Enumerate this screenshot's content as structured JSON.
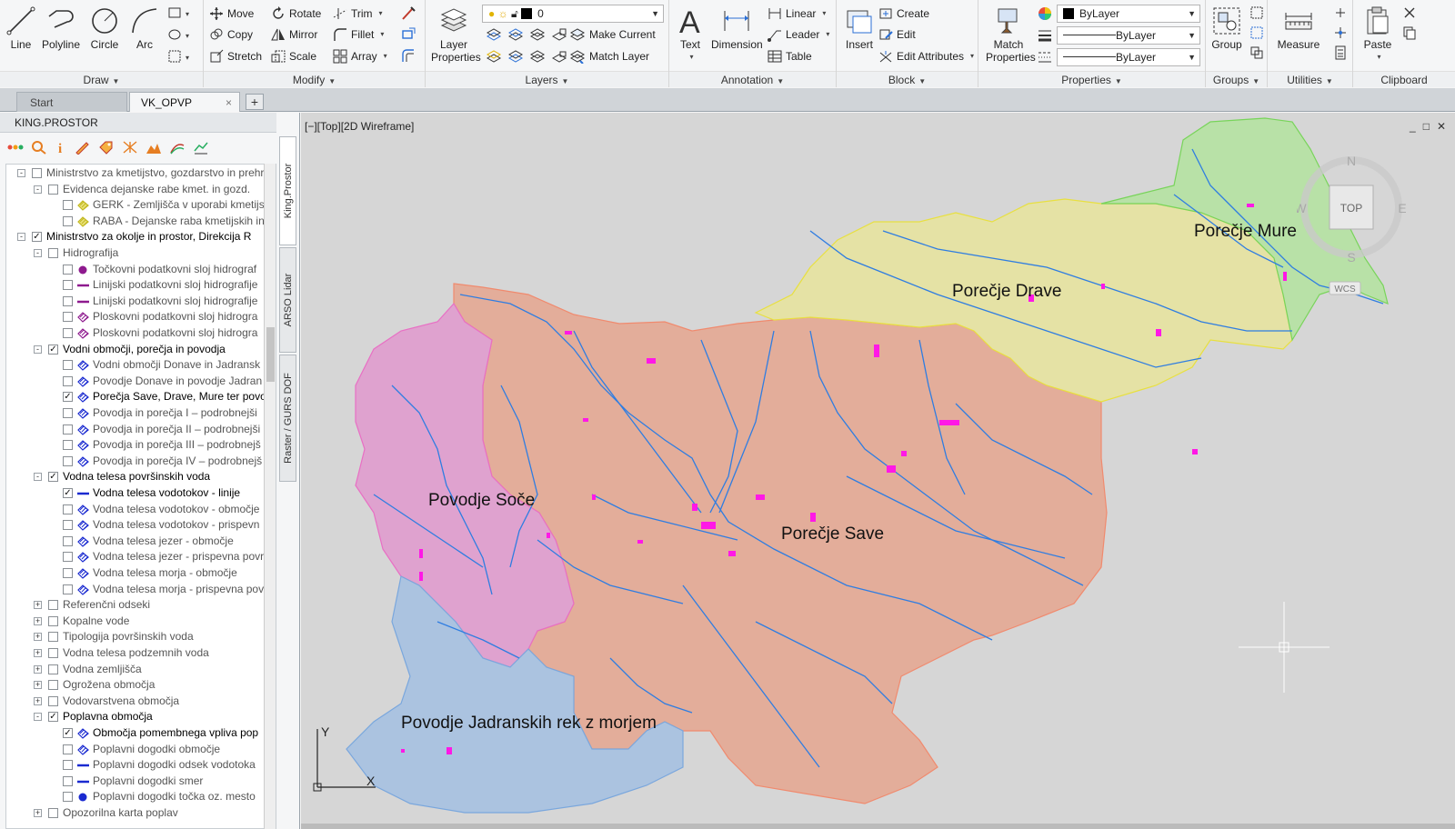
{
  "ribbon": {
    "panels": {
      "draw": "Draw",
      "modify": "Modify",
      "layers": "Layers",
      "annotation": "Annotation",
      "block": "Block",
      "properties": "Properties",
      "groups": "Groups",
      "utilities": "Utilities",
      "clipboard": "Clipboard"
    },
    "draw": {
      "line": "Line",
      "polyline": "Polyline",
      "circle": "Circle",
      "arc": "Arc"
    },
    "modify": {
      "move": "Move",
      "rotate": "Rotate",
      "trim": "Trim",
      "copy": "Copy",
      "mirror": "Mirror",
      "fillet": "Fillet",
      "stretch": "Stretch",
      "scale": "Scale",
      "array": "Array"
    },
    "layers": {
      "layer_properties_1": "Layer",
      "layer_properties_2": "Properties",
      "current_layer": "0",
      "make_current": "Make Current",
      "match_layer": "Match Layer"
    },
    "annotation": {
      "text": "Text",
      "dimension": "Dimension",
      "linear": "Linear",
      "leader": "Leader",
      "table": "Table"
    },
    "block": {
      "insert": "Insert",
      "create": "Create",
      "edit": "Edit",
      "edit_attributes": "Edit Attributes"
    },
    "properties": {
      "match_1": "Match",
      "match_2": "Properties",
      "color": "ByLayer",
      "lineweight": "ByLayer",
      "linetype": "ByLayer"
    },
    "groups": {
      "group": "Group"
    },
    "utilities": {
      "measure": "Measure"
    },
    "clipboard": {
      "paste": "Paste"
    }
  },
  "tabs": [
    {
      "label": "Start"
    },
    {
      "label": "VK_OPVP"
    }
  ],
  "tabs_close": "×",
  "tabs_add": "+",
  "left_panel": {
    "title": "KING.PROSTOR",
    "side_tabs": [
      "King.Prostor",
      "ARSO Lidar",
      "Raster / GURS DOF"
    ],
    "tree": [
      {
        "level": 0,
        "exp": "-",
        "cb": "",
        "icon": "",
        "label": "Ministrstvo za kmetijstvo, gozdarstvo in prehr",
        "bold": false
      },
      {
        "level": 1,
        "exp": "-",
        "cb": "",
        "icon": "",
        "label": "Evidenca dejanske rabe kmet. in gozd.",
        "bold": false
      },
      {
        "level": 2,
        "exp": "",
        "cb": "",
        "icon": "hatch-yellow",
        "label": "GERK - Zemljišča v uporabi kmetijs",
        "bold": false
      },
      {
        "level": 2,
        "exp": "",
        "cb": "",
        "icon": "hatch-yellow",
        "label": "RABA - Dejanske raba kmetijskih in",
        "bold": false
      },
      {
        "level": 0,
        "exp": "-",
        "cb": "✓",
        "icon": "",
        "label": "Ministrstvo za okolje in prostor, Direkcija R",
        "bold": true
      },
      {
        "level": 1,
        "exp": "-",
        "cb": "",
        "icon": "",
        "label": "Hidrografija",
        "bold": false
      },
      {
        "level": 2,
        "exp": "",
        "cb": "",
        "icon": "point-purple",
        "label": "Točkovni podatkovni sloj hidrograf",
        "bold": false
      },
      {
        "level": 2,
        "exp": "",
        "cb": "",
        "icon": "line-purple",
        "label": "Linijski podatkovni sloj hidrografije",
        "bold": false
      },
      {
        "level": 2,
        "exp": "",
        "cb": "",
        "icon": "line-purple",
        "label": "Linijski podatkovni sloj hidrografije",
        "bold": false
      },
      {
        "level": 2,
        "exp": "",
        "cb": "",
        "icon": "hatch-purple",
        "label": "Ploskovni podatkovni sloj hidrogra",
        "bold": false
      },
      {
        "level": 2,
        "exp": "",
        "cb": "",
        "icon": "hatch-purple",
        "label": "Ploskovni podatkovni sloj hidrogra",
        "bold": false
      },
      {
        "level": 1,
        "exp": "-",
        "cb": "✓",
        "icon": "",
        "label": "Vodni območji, porečja in povodja",
        "bold": true
      },
      {
        "level": 2,
        "exp": "",
        "cb": "",
        "icon": "hatch-blue",
        "label": "Vodni območji Donave in Jadransk",
        "bold": false
      },
      {
        "level": 2,
        "exp": "",
        "cb": "",
        "icon": "hatch-blue",
        "label": "Povodje Donave in povodje Jadran",
        "bold": false
      },
      {
        "level": 2,
        "exp": "",
        "cb": "✓",
        "icon": "hatch-blue",
        "label": "Porečja Save, Drave, Mure ter povo",
        "bold": true
      },
      {
        "level": 2,
        "exp": "",
        "cb": "",
        "icon": "hatch-blue",
        "label": "Povodja in porečja I – podrobnejši",
        "bold": false
      },
      {
        "level": 2,
        "exp": "",
        "cb": "",
        "icon": "hatch-blue",
        "label": "Povodja in porečja II – podrobnejši",
        "bold": false
      },
      {
        "level": 2,
        "exp": "",
        "cb": "",
        "icon": "hatch-blue",
        "label": "Povodja in porečja III – podrobnejš",
        "bold": false
      },
      {
        "level": 2,
        "exp": "",
        "cb": "",
        "icon": "hatch-blue",
        "label": "Povodja in porečja IV – podrobnejš",
        "bold": false
      },
      {
        "level": 1,
        "exp": "-",
        "cb": "✓",
        "icon": "",
        "label": "Vodna telesa površinskih voda",
        "bold": true
      },
      {
        "level": 2,
        "exp": "",
        "cb": "✓",
        "icon": "line-blue",
        "label": "Vodna telesa vodotokov - linije",
        "bold": true
      },
      {
        "level": 2,
        "exp": "",
        "cb": "",
        "icon": "hatch-blue",
        "label": "Vodna telesa vodotokov - območje",
        "bold": false
      },
      {
        "level": 2,
        "exp": "",
        "cb": "",
        "icon": "hatch-blue",
        "label": "Vodna telesa vodotokov - prispevn",
        "bold": false
      },
      {
        "level": 2,
        "exp": "",
        "cb": "",
        "icon": "hatch-blue",
        "label": "Vodna telesa jezer - območje",
        "bold": false
      },
      {
        "level": 2,
        "exp": "",
        "cb": "",
        "icon": "hatch-blue",
        "label": "Vodna telesa jezer - prispevna povr",
        "bold": false
      },
      {
        "level": 2,
        "exp": "",
        "cb": "",
        "icon": "hatch-blue",
        "label": "Vodna telesa morja - območje",
        "bold": false
      },
      {
        "level": 2,
        "exp": "",
        "cb": "",
        "icon": "hatch-blue",
        "label": "Vodna telesa morja - prispevna pov",
        "bold": false
      },
      {
        "level": 1,
        "exp": "+",
        "cb": "",
        "icon": "",
        "label": "Referenčni odseki",
        "bold": false
      },
      {
        "level": 1,
        "exp": "+",
        "cb": "",
        "icon": "",
        "label": "Kopalne vode",
        "bold": false
      },
      {
        "level": 1,
        "exp": "+",
        "cb": "",
        "icon": "",
        "label": "Tipologija površinskih voda",
        "bold": false
      },
      {
        "level": 1,
        "exp": "+",
        "cb": "",
        "icon": "",
        "label": "Vodna telesa podzemnih voda",
        "bold": false
      },
      {
        "level": 1,
        "exp": "+",
        "cb": "",
        "icon": "",
        "label": "Vodna zemljišča",
        "bold": false
      },
      {
        "level": 1,
        "exp": "+",
        "cb": "",
        "icon": "",
        "label": "Ogrožena območja",
        "bold": false
      },
      {
        "level": 1,
        "exp": "+",
        "cb": "",
        "icon": "",
        "label": "Vodovarstvena območja",
        "bold": false
      },
      {
        "level": 1,
        "exp": "-",
        "cb": "✓",
        "icon": "",
        "label": "Poplavna območja",
        "bold": true
      },
      {
        "level": 2,
        "exp": "",
        "cb": "✓",
        "icon": "hatch-blue",
        "label": "Območja pomembnega vpliva pop",
        "bold": true
      },
      {
        "level": 2,
        "exp": "",
        "cb": "",
        "icon": "hatch-blue",
        "label": "Poplavni dogodki območje",
        "bold": false
      },
      {
        "level": 2,
        "exp": "",
        "cb": "",
        "icon": "line-blue",
        "label": "Poplavni dogodki odsek vodotoka",
        "bold": false
      },
      {
        "level": 2,
        "exp": "",
        "cb": "",
        "icon": "line-blue",
        "label": "Poplavni dogodki smer",
        "bold": false
      },
      {
        "level": 2,
        "exp": "",
        "cb": "",
        "icon": "point-blue",
        "label": "Poplavni dogodki točka oz. mesto",
        "bold": false
      },
      {
        "level": 1,
        "exp": "+",
        "cb": "",
        "icon": "",
        "label": "Opozorilna karta poplav",
        "bold": false
      }
    ]
  },
  "viewport": {
    "label": "[−][Top][2D Wireframe]",
    "controls": [
      "_",
      "□",
      "✕"
    ],
    "viewcube": {
      "n": "N",
      "s": "S",
      "e": "E",
      "w": "W",
      "top": "TOP",
      "wcs": "WCS"
    },
    "ucs": {
      "x": "X",
      "y": "Y"
    }
  },
  "map": {
    "labels": {
      "mure": "Porečje Mure",
      "drave": "Porečje Drave",
      "soce": "Povodje Soče",
      "save": "Porečje Save",
      "jadran": "Povodje Jadranskih rek z morjem"
    },
    "colors": {
      "save": "#e4ab97",
      "soce": "#df9fcf",
      "jadran": "#a9c2e0",
      "drave": "#e6e3a2",
      "mure": "#b6e2a4",
      "river": "#2f7de1",
      "flood": "#ff18e6"
    }
  }
}
